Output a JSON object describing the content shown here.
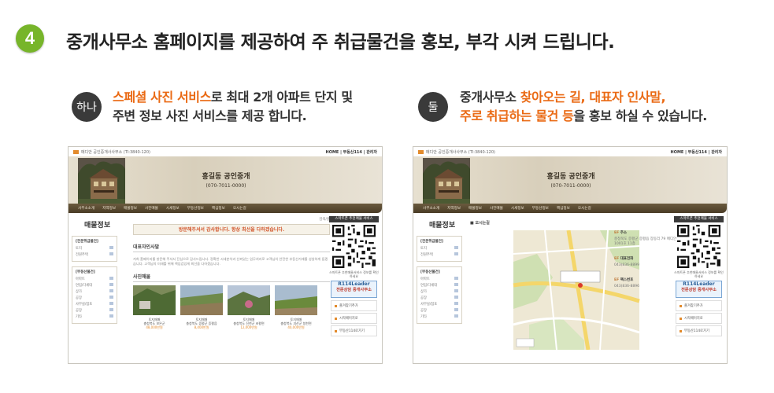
{
  "step": {
    "number": "4",
    "headline": "중개사무소 홈페이지를 제공하여 주 취급물건을 홍보, 부각 시켜 드립니다."
  },
  "left": {
    "badge": "하나",
    "line1_hl": "스페셜 사진 서비스",
    "line1_rest": "로 최대 2개 아파트 단지 및",
    "line2": "주변 정보 사진 서비스를 제공 합니다."
  },
  "right": {
    "badge": "둘",
    "line1_a": "중개사무소 ",
    "line1_hl": "찾아오는 길, 대표자 인사말,",
    "line2_hl": "주로 취급하는 물건 등",
    "line2_rest": "을 홍보 하실 수 있습니다."
  },
  "site": {
    "top_left": "메디안 공인중개사사무소 (TI:3840-120)",
    "top_right": "HOME | 부동산114 | 관리자",
    "brand": "홍길동 공인중개",
    "phone": "(070-7011-0000)",
    "nav": [
      "사무소소개",
      "지역정보",
      "매물정보",
      "사진매물",
      "시세정보",
      "부동산정보",
      "핵심정보",
      "오시는길"
    ],
    "sidebar": {
      "box1_title": "[전문취급물건]",
      "box1_items": [
        "토지",
        "전원주택"
      ],
      "box2_title": "[부동산물건]",
      "box2_items": [
        "아파트",
        "연립/다세대",
        "상가",
        "공장",
        "사무실/점포",
        "공장",
        "기타"
      ]
    },
    "right_panel": {
      "header": "스마트폰 추천매물 서비스",
      "qr_text": "스마트폰 추천매물서비스 정보를 확인하세요",
      "ad_top": "R114Leader",
      "ad_bottom": "전문상담 중개사무소",
      "links": [
        "즐겨찾기추가",
        "시작페이지로",
        "부동산114로가기"
      ]
    }
  },
  "shot1": {
    "page_title": "매물정보",
    "crumb": "검색/출",
    "welcome": "방문해주셔서 감사합니다. 항상 최선을 다하겠습니다.",
    "section1": "대표자인사말",
    "para": "저희 홈페이지를 방문해 주셔서 진심으로 감사드립니다. 정확한 시세분석과 신뢰있는 업무처리로 고객님의 안전한 부동산거래를 성실하게 돕겠습니다. 고객님의 미래를 위해 책임감있게 최선을 다하겠습니다.",
    "section2": "사진매물",
    "thumbs": [
      {
        "title": "토지매매",
        "addr": "충청북도 보은군",
        "price": "48,000만원"
      },
      {
        "title": "토지매매",
        "addr": "충청북도 증평군 증평읍",
        "price": "8,400만원"
      },
      {
        "title": "토지매매",
        "addr": "충청북도 진천군 초평면",
        "price": "12,000만원"
      },
      {
        "title": "토지매매",
        "addr": "충청북도 괴산군 청천면",
        "price": "40,000만원"
      }
    ]
  },
  "shot2": {
    "page_title": "매물정보",
    "map_title": "오시는길",
    "info": [
      {
        "label": "주소",
        "value": "충청북도 증평군 증평읍 장동리 79 메디안1001호 11층"
      },
      {
        "label": "대표전화",
        "value": "043)836-8899"
      },
      {
        "label": "팩스번호",
        "value": "043)836-8896"
      }
    ]
  },
  "colors": {
    "step": "#77b52a",
    "badge": "#3a3a3a",
    "highlight": "#ea6a14",
    "nav": "#5a4a30"
  }
}
